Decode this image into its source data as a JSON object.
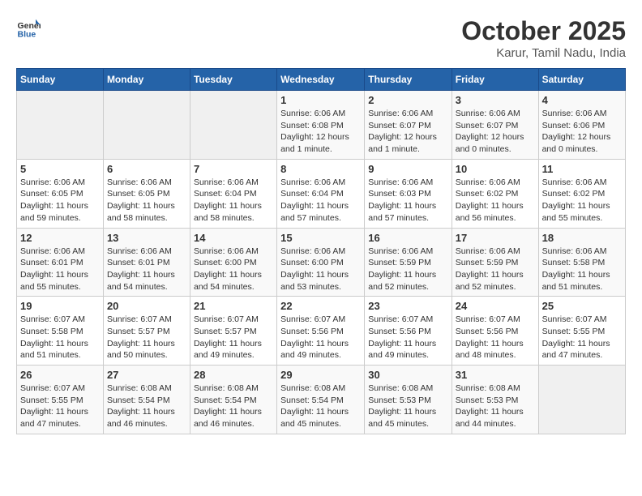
{
  "header": {
    "logo_general": "General",
    "logo_blue": "Blue",
    "month": "October 2025",
    "location": "Karur, Tamil Nadu, India"
  },
  "days_of_week": [
    "Sunday",
    "Monday",
    "Tuesday",
    "Wednesday",
    "Thursday",
    "Friday",
    "Saturday"
  ],
  "weeks": [
    [
      {
        "day": "",
        "detail": ""
      },
      {
        "day": "",
        "detail": ""
      },
      {
        "day": "",
        "detail": ""
      },
      {
        "day": "1",
        "detail": "Sunrise: 6:06 AM\nSunset: 6:08 PM\nDaylight: 12 hours\nand 1 minute."
      },
      {
        "day": "2",
        "detail": "Sunrise: 6:06 AM\nSunset: 6:07 PM\nDaylight: 12 hours\nand 1 minute."
      },
      {
        "day": "3",
        "detail": "Sunrise: 6:06 AM\nSunset: 6:07 PM\nDaylight: 12 hours\nand 0 minutes."
      },
      {
        "day": "4",
        "detail": "Sunrise: 6:06 AM\nSunset: 6:06 PM\nDaylight: 12 hours\nand 0 minutes."
      }
    ],
    [
      {
        "day": "5",
        "detail": "Sunrise: 6:06 AM\nSunset: 6:05 PM\nDaylight: 11 hours\nand 59 minutes."
      },
      {
        "day": "6",
        "detail": "Sunrise: 6:06 AM\nSunset: 6:05 PM\nDaylight: 11 hours\nand 58 minutes."
      },
      {
        "day": "7",
        "detail": "Sunrise: 6:06 AM\nSunset: 6:04 PM\nDaylight: 11 hours\nand 58 minutes."
      },
      {
        "day": "8",
        "detail": "Sunrise: 6:06 AM\nSunset: 6:04 PM\nDaylight: 11 hours\nand 57 minutes."
      },
      {
        "day": "9",
        "detail": "Sunrise: 6:06 AM\nSunset: 6:03 PM\nDaylight: 11 hours\nand 57 minutes."
      },
      {
        "day": "10",
        "detail": "Sunrise: 6:06 AM\nSunset: 6:02 PM\nDaylight: 11 hours\nand 56 minutes."
      },
      {
        "day": "11",
        "detail": "Sunrise: 6:06 AM\nSunset: 6:02 PM\nDaylight: 11 hours\nand 55 minutes."
      }
    ],
    [
      {
        "day": "12",
        "detail": "Sunrise: 6:06 AM\nSunset: 6:01 PM\nDaylight: 11 hours\nand 55 minutes."
      },
      {
        "day": "13",
        "detail": "Sunrise: 6:06 AM\nSunset: 6:01 PM\nDaylight: 11 hours\nand 54 minutes."
      },
      {
        "day": "14",
        "detail": "Sunrise: 6:06 AM\nSunset: 6:00 PM\nDaylight: 11 hours\nand 54 minutes."
      },
      {
        "day": "15",
        "detail": "Sunrise: 6:06 AM\nSunset: 6:00 PM\nDaylight: 11 hours\nand 53 minutes."
      },
      {
        "day": "16",
        "detail": "Sunrise: 6:06 AM\nSunset: 5:59 PM\nDaylight: 11 hours\nand 52 minutes."
      },
      {
        "day": "17",
        "detail": "Sunrise: 6:06 AM\nSunset: 5:59 PM\nDaylight: 11 hours\nand 52 minutes."
      },
      {
        "day": "18",
        "detail": "Sunrise: 6:06 AM\nSunset: 5:58 PM\nDaylight: 11 hours\nand 51 minutes."
      }
    ],
    [
      {
        "day": "19",
        "detail": "Sunrise: 6:07 AM\nSunset: 5:58 PM\nDaylight: 11 hours\nand 51 minutes."
      },
      {
        "day": "20",
        "detail": "Sunrise: 6:07 AM\nSunset: 5:57 PM\nDaylight: 11 hours\nand 50 minutes."
      },
      {
        "day": "21",
        "detail": "Sunrise: 6:07 AM\nSunset: 5:57 PM\nDaylight: 11 hours\nand 49 minutes."
      },
      {
        "day": "22",
        "detail": "Sunrise: 6:07 AM\nSunset: 5:56 PM\nDaylight: 11 hours\nand 49 minutes."
      },
      {
        "day": "23",
        "detail": "Sunrise: 6:07 AM\nSunset: 5:56 PM\nDaylight: 11 hours\nand 49 minutes."
      },
      {
        "day": "24",
        "detail": "Sunrise: 6:07 AM\nSunset: 5:56 PM\nDaylight: 11 hours\nand 48 minutes."
      },
      {
        "day": "25",
        "detail": "Sunrise: 6:07 AM\nSunset: 5:55 PM\nDaylight: 11 hours\nand 47 minutes."
      }
    ],
    [
      {
        "day": "26",
        "detail": "Sunrise: 6:07 AM\nSunset: 5:55 PM\nDaylight: 11 hours\nand 47 minutes."
      },
      {
        "day": "27",
        "detail": "Sunrise: 6:08 AM\nSunset: 5:54 PM\nDaylight: 11 hours\nand 46 minutes."
      },
      {
        "day": "28",
        "detail": "Sunrise: 6:08 AM\nSunset: 5:54 PM\nDaylight: 11 hours\nand 46 minutes."
      },
      {
        "day": "29",
        "detail": "Sunrise: 6:08 AM\nSunset: 5:54 PM\nDaylight: 11 hours\nand 45 minutes."
      },
      {
        "day": "30",
        "detail": "Sunrise: 6:08 AM\nSunset: 5:53 PM\nDaylight: 11 hours\nand 45 minutes."
      },
      {
        "day": "31",
        "detail": "Sunrise: 6:08 AM\nSunset: 5:53 PM\nDaylight: 11 hours\nand 44 minutes."
      },
      {
        "day": "",
        "detail": ""
      }
    ]
  ]
}
